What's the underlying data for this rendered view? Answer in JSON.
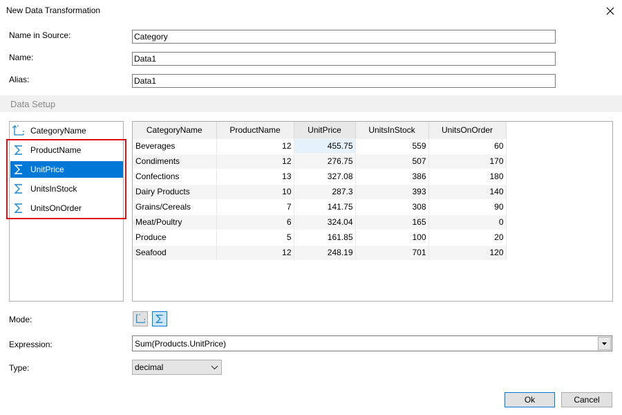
{
  "window": {
    "title": "New Data Transformation"
  },
  "form": {
    "name_in_source_label": "Name in Source:",
    "name_in_source_value": "Category",
    "name_label": "Name:",
    "name_value": "Data1",
    "alias_label": "Alias:",
    "alias_value": "Data1"
  },
  "section": {
    "title": "Data Setup"
  },
  "columns_list": [
    {
      "label": "CategoryName",
      "icon": "dimension-icon",
      "selected": false
    },
    {
      "label": "ProductName",
      "icon": "sigma-icon",
      "selected": false
    },
    {
      "label": "UnitPrice",
      "icon": "sigma-icon",
      "selected": true
    },
    {
      "label": "UnitsInStock",
      "icon": "sigma-icon",
      "selected": false
    },
    {
      "label": "UnitsOnOrder",
      "icon": "sigma-icon",
      "selected": false
    }
  ],
  "grid": {
    "headers": [
      "CategoryName",
      "ProductName",
      "UnitPrice",
      "UnitsInStock",
      "UnitsOnOrder"
    ],
    "rows": [
      [
        "Beverages",
        "12",
        "455.75",
        "559",
        "60"
      ],
      [
        "Condiments",
        "12",
        "276.75",
        "507",
        "170"
      ],
      [
        "Confections",
        "13",
        "327.08",
        "386",
        "180"
      ],
      [
        "Dairy Products",
        "10",
        "287.3",
        "393",
        "140"
      ],
      [
        "Grains/Cereals",
        "7",
        "141.75",
        "308",
        "90"
      ],
      [
        "Meat/Poultry",
        "6",
        "324.04",
        "165",
        "0"
      ],
      [
        "Produce",
        "5",
        "161.85",
        "100",
        "20"
      ],
      [
        "Seafood",
        "12",
        "248.19",
        "701",
        "120"
      ]
    ]
  },
  "mode": {
    "label": "Mode:",
    "active": "summary"
  },
  "expression": {
    "label": "Expression:",
    "value": "Sum(Products.UnitPrice)"
  },
  "type": {
    "label": "Type:",
    "value": "decimal"
  },
  "buttons": {
    "ok": "Ok",
    "cancel": "Cancel"
  },
  "colors": {
    "accent": "#0078d7",
    "highlight_border": "#e01010",
    "sigma_icon": "#1a86c8",
    "section_bg": "#f0f0f0"
  }
}
